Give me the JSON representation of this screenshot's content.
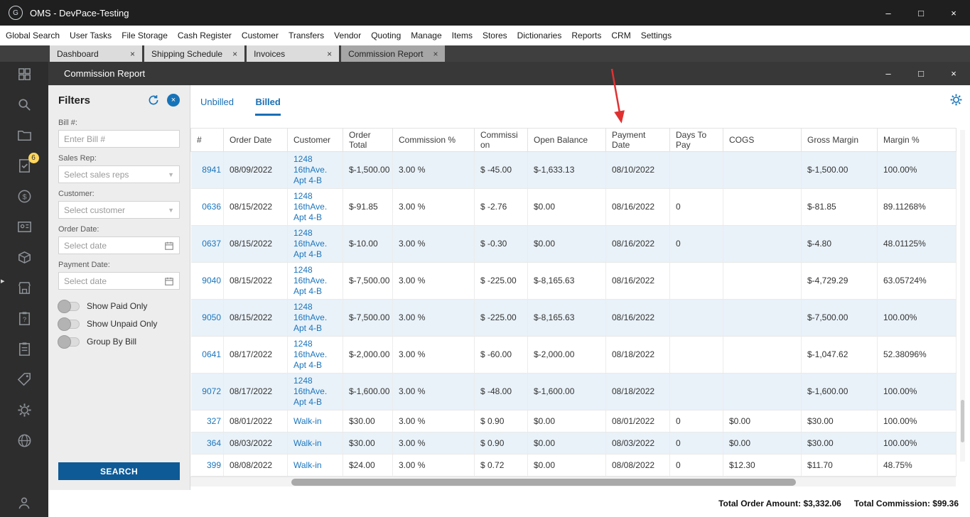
{
  "window": {
    "title": "OMS - DevPace-Testing",
    "logo_glyph": "G"
  },
  "icons": {
    "minimize": "–",
    "maximize": "□",
    "close": "×",
    "tab_close": "×",
    "dropdown": "▼",
    "expander": "▸"
  },
  "menu": {
    "items": [
      "Global Search",
      "User Tasks",
      "File Storage",
      "Cash Register",
      "Customer",
      "Transfers",
      "Vendor",
      "Quoting",
      "Manage",
      "Items",
      "Stores",
      "Dictionaries",
      "Reports",
      "CRM",
      "Settings"
    ]
  },
  "tabs": [
    {
      "label": "Dashboard",
      "active": false
    },
    {
      "label": "Shipping Schedule",
      "active": false
    },
    {
      "label": "Invoices",
      "active": false
    },
    {
      "label": "Commission Report",
      "active": true
    }
  ],
  "sidebar": {
    "badge": "6",
    "icons": [
      "dashboard-icon",
      "search-icon",
      "folder-icon",
      "tasks-icon",
      "money-icon",
      "contact-icon",
      "inventory-icon",
      "store-icon",
      "help-clipboard-icon",
      "clipboard-icon",
      "tag-icon",
      "gear-icon",
      "globe-icon"
    ],
    "bottom_icon": "user-icon"
  },
  "inner_window": {
    "title": "Commission Report"
  },
  "filters": {
    "title": "Filters",
    "bill_label": "Bill #:",
    "bill_placeholder": "Enter Bill #",
    "sales_rep_label": "Sales Rep:",
    "sales_rep_placeholder": "Select sales reps",
    "customer_label": "Customer:",
    "customer_placeholder": "Select customer",
    "order_date_label": "Order Date:",
    "order_date_placeholder": "Select date",
    "payment_date_label": "Payment Date:",
    "payment_date_placeholder": "Select date",
    "toggles": [
      "Show Paid Only",
      "Show Unpaid Only",
      "Group By Bill"
    ],
    "search_label": "SEARCH"
  },
  "report": {
    "tabs": [
      "Unbilled",
      "Billed"
    ],
    "active_tab": "Billed",
    "columns": [
      "#",
      "Order Date",
      "Customer",
      "Order Total",
      "Commission %",
      "Commission",
      "Open Balance",
      "Payment Date",
      "Days To Pay",
      "COGS",
      "Gross Margin",
      "Margin %"
    ],
    "rows": [
      [
        "8941",
        "08/09/2022",
        "1248 16thAve. Apt 4-B",
        "$-1,500.00",
        "3.00 %",
        "$ -45.00",
        "$-1,633.13",
        "08/10/2022",
        "",
        "",
        "$-1,500.00",
        "100.00%"
      ],
      [
        "0636",
        "08/15/2022",
        "1248 16thAve. Apt 4-B",
        "$-91.85",
        "3.00 %",
        "$ -2.76",
        "$0.00",
        "08/16/2022",
        "0",
        "",
        "$-81.85",
        "89.11268%"
      ],
      [
        "0637",
        "08/15/2022",
        "1248 16thAve. Apt 4-B",
        "$-10.00",
        "3.00 %",
        "$ -0.30",
        "$0.00",
        "08/16/2022",
        "0",
        "",
        "$-4.80",
        "48.01125%"
      ],
      [
        "9040",
        "08/15/2022",
        "1248 16thAve. Apt 4-B",
        "$-7,500.00",
        "3.00 %",
        "$ -225.00",
        "$-8,165.63",
        "08/16/2022",
        "",
        "",
        "$-4,729.29",
        "63.05724%"
      ],
      [
        "9050",
        "08/15/2022",
        "1248 16thAve. Apt 4-B",
        "$-7,500.00",
        "3.00 %",
        "$ -225.00",
        "$-8,165.63",
        "08/16/2022",
        "",
        "",
        "$-7,500.00",
        "100.00%"
      ],
      [
        "0641",
        "08/17/2022",
        "1248 16thAve. Apt 4-B",
        "$-2,000.00",
        "3.00 %",
        "$ -60.00",
        "$-2,000.00",
        "08/18/2022",
        "",
        "",
        "$-1,047.62",
        "52.38096%"
      ],
      [
        "9072",
        "08/17/2022",
        "1248 16thAve. Apt 4-B",
        "$-1,600.00",
        "3.00 %",
        "$ -48.00",
        "$-1,600.00",
        "08/18/2022",
        "",
        "",
        "$-1,600.00",
        "100.00%"
      ],
      [
        "327",
        "08/01/2022",
        "Walk-in",
        "$30.00",
        "3.00 %",
        "$ 0.90",
        "$0.00",
        "08/01/2022",
        "0",
        "$0.00",
        "$30.00",
        "100.00%"
      ],
      [
        "364",
        "08/03/2022",
        "Walk-in",
        "$30.00",
        "3.00 %",
        "$ 0.90",
        "$0.00",
        "08/03/2022",
        "0",
        "$0.00",
        "$30.00",
        "100.00%"
      ],
      [
        "399",
        "08/08/2022",
        "Walk-in",
        "$24.00",
        "3.00 %",
        "$ 0.72",
        "$0.00",
        "08/08/2022",
        "0",
        "$12.30",
        "$11.70",
        "48.75%"
      ]
    ],
    "totals": {
      "order_label": "Total Order Amount:",
      "order_value": "$3,332.06",
      "commission_label": "Total Commission:",
      "commission_value": "$99.36"
    }
  },
  "colors": {
    "accent_blue": "#1a6fb5",
    "link_blue": "#1b75bc",
    "search_button": "#0d5a96",
    "stripe": "#e9f2f9",
    "annotation_red": "#e03131"
  }
}
